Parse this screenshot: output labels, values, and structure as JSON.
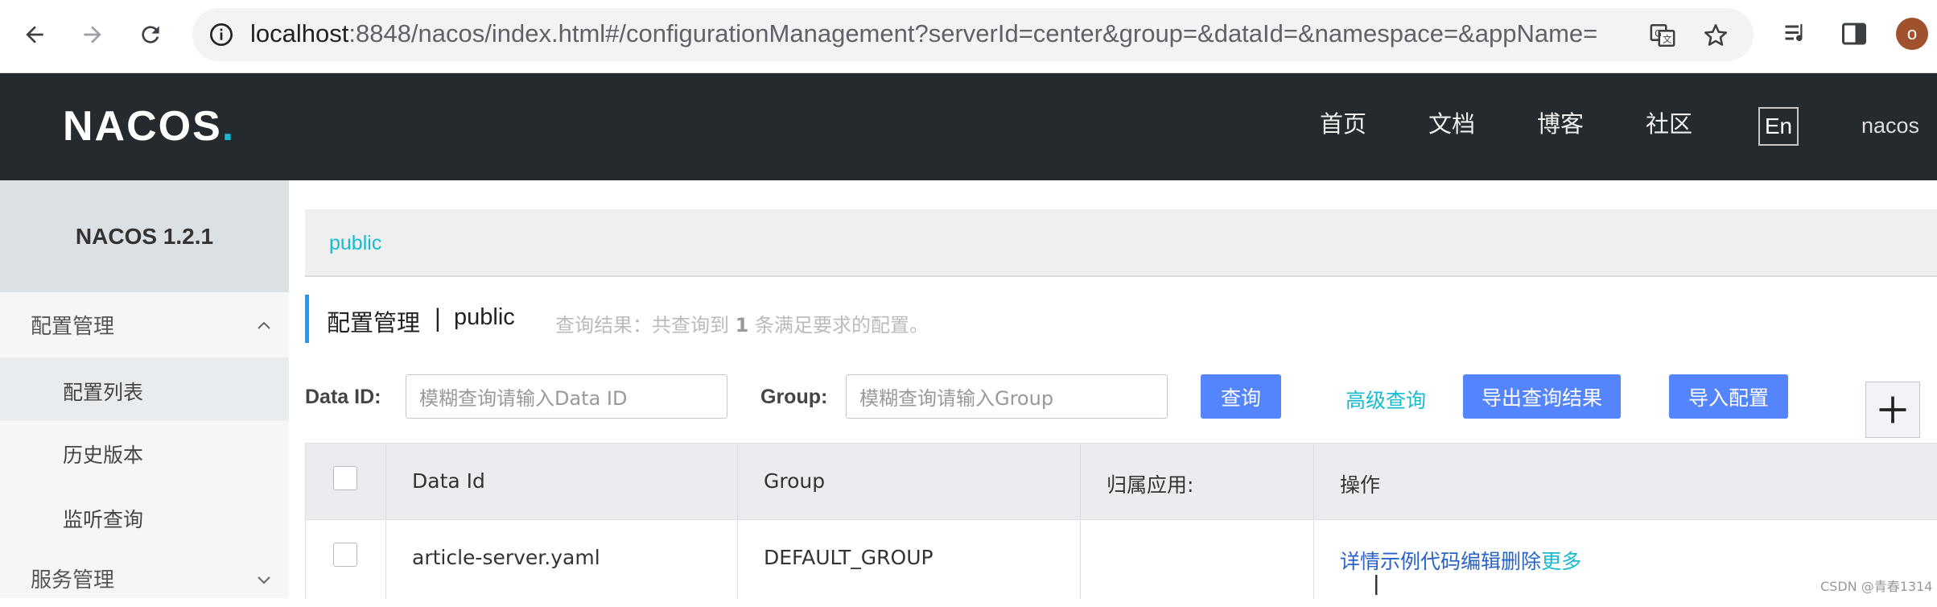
{
  "browser": {
    "url_host": "localhost",
    "url_rest": ":8848/nacos/index.html#/configurationManagement?serverId=center&group=&dataId=&namespace=&appName=",
    "profile_initial": "o"
  },
  "header": {
    "logo": "NACOS",
    "logo_dot": ".",
    "nav": [
      "首页",
      "文档",
      "博客",
      "社区"
    ],
    "lang": "En",
    "user": "nacos"
  },
  "sidebar": {
    "title": "NACOS 1.2.1",
    "group_config": "配置管理",
    "items": [
      "配置列表",
      "历史版本",
      "监听查询"
    ],
    "group_service": "服务管理"
  },
  "namespace": {
    "current": "public"
  },
  "title": {
    "main": "配置管理",
    "sep": "|",
    "ns": "public",
    "result_prefix": "查询结果：共查询到",
    "result_count": "1",
    "result_suffix": "条满足要求的配置。"
  },
  "filters": {
    "dataid_label": "Data ID:",
    "dataid_placeholder": "模糊查询请输入Data ID",
    "group_label": "Group:",
    "group_placeholder": "模糊查询请输入Group",
    "query_btn": "查询",
    "advanced": "高级查询",
    "export_btn": "导出查询结果",
    "import_btn": "导入配置"
  },
  "table": {
    "headers": [
      "Data Id",
      "Group",
      "归属应用:",
      "操作"
    ],
    "rows": [
      {
        "data_id": "article-server.yaml",
        "group": "DEFAULT_GROUP",
        "app": "",
        "ops": [
          "详情",
          "示例代码",
          "编辑",
          "删除",
          "更多"
        ]
      }
    ]
  },
  "watermark": "CSDN @青春1314"
}
